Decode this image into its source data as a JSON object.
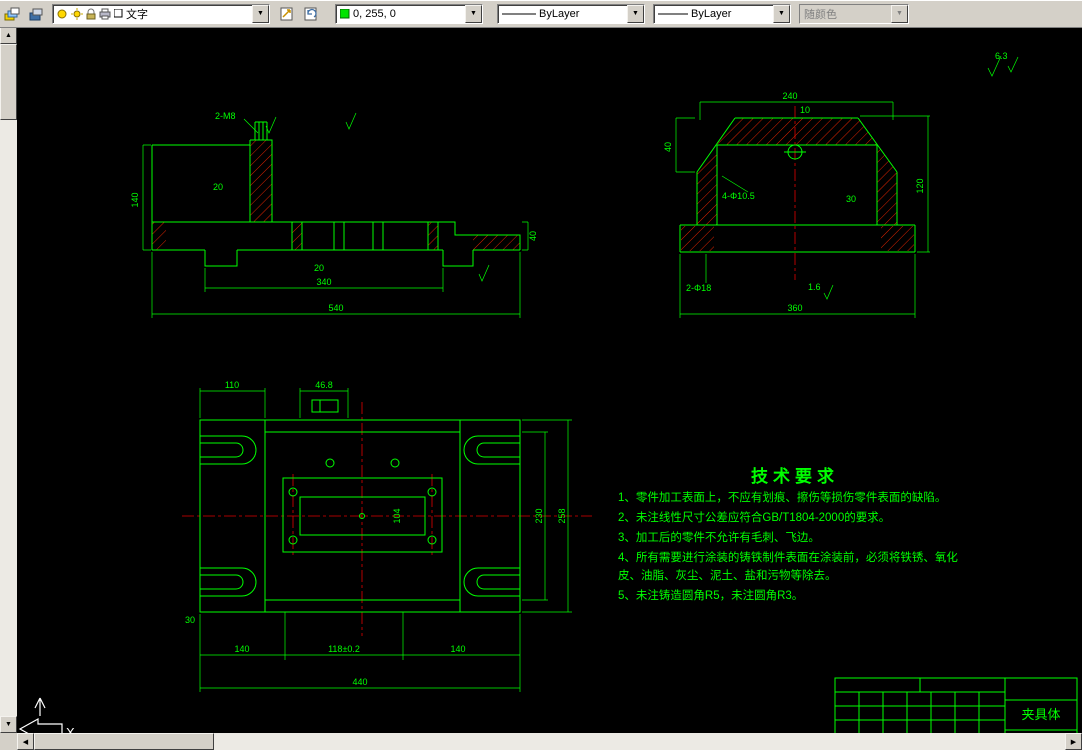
{
  "toolbar": {
    "layer_combo_value": "文字",
    "color_combo_value": "0, 255, 0",
    "linetype_combo_value": "ByLayer",
    "lineweight_combo_value": "ByLayer",
    "plotstyle_combo_value": "随颜色"
  },
  "icons": {
    "dropdown": "▼",
    "scroll_up": "▲",
    "scroll_down": "▼",
    "scroll_left": "◀",
    "scroll_right": "▶"
  },
  "colors": {
    "drawing_green": "#00ff00",
    "hatch_red": "#dd2200",
    "centerline_red": "#e00000",
    "color_swatch": "#00e400"
  },
  "surface_note": "6.3",
  "views": {
    "front": {
      "dims": {
        "thread": "2-M8",
        "d20_wall": "20",
        "d140": "140",
        "d20_slot": "20",
        "d340": "340",
        "d540": "540",
        "d40": "40"
      }
    },
    "side": {
      "dims": {
        "d240": "240",
        "d10": "10",
        "d40": "40",
        "d120": "120",
        "d360": "360",
        "d30": "30",
        "holes_top": "4-Φ10.5",
        "holes_bottom": "2-Φ18",
        "rough": "1.6"
      }
    },
    "plan": {
      "dims": {
        "d110": "110",
        "d468": "46.8",
        "d30": "30",
        "d140a": "140",
        "d118": "118±0.2",
        "d140b": "140",
        "d440": "440",
        "d230": "230",
        "d258": "258",
        "d104": "104"
      }
    }
  },
  "tech_requirements": {
    "title": "技术要求",
    "items": [
      "1、零件加工表面上，不应有划痕、擦伤等损伤零件表面的缺陷。",
      "2、未注线性尺寸公差应符合GB/T1804-2000的要求。",
      "3、加工后的零件不允许有毛刺、飞边。",
      "4、所有需要进行涂装的铸铁制件表面在涂装前，必须将铁锈、氧化皮、油脂、灰尘、泥土、盐和污物等除去。",
      "5、未注铸造圆角R5，未注圆角R3。"
    ]
  },
  "title_block": {
    "part_name": "夹具体"
  },
  "ucs": {
    "x_label": "X"
  }
}
